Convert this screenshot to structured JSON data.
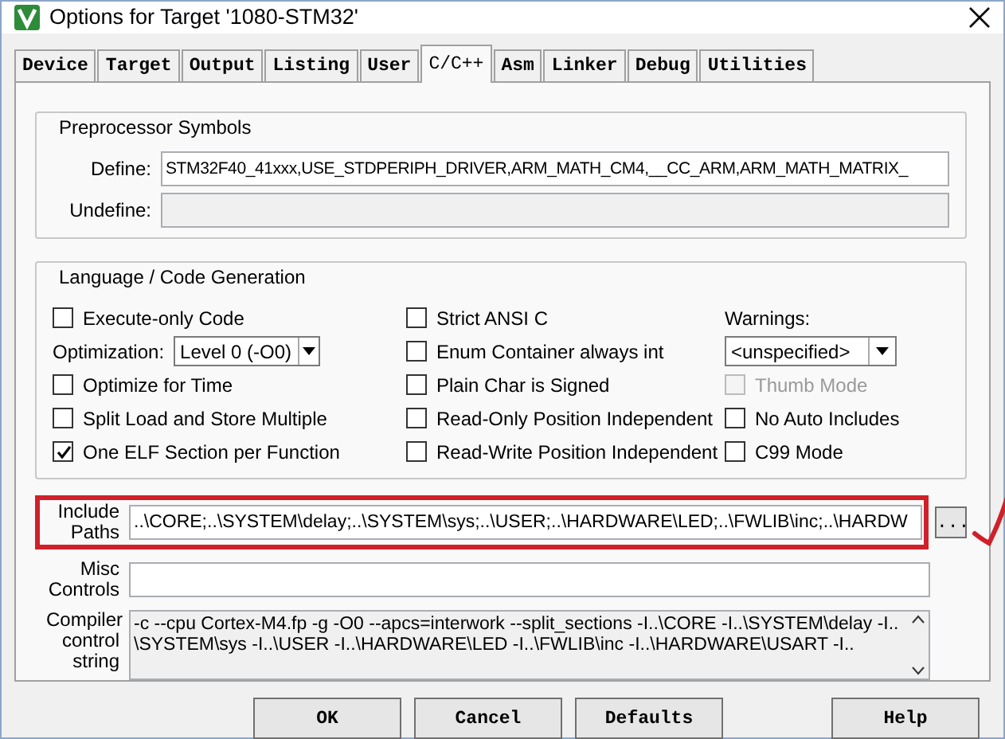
{
  "window": {
    "title": "Options for Target '1080-STM32'"
  },
  "tabs": [
    {
      "label": "Device",
      "selected": false
    },
    {
      "label": "Target",
      "selected": false
    },
    {
      "label": "Output",
      "selected": false
    },
    {
      "label": "Listing",
      "selected": false
    },
    {
      "label": "User",
      "selected": false
    },
    {
      "label": "C/C++",
      "selected": true
    },
    {
      "label": "Asm",
      "selected": false
    },
    {
      "label": "Linker",
      "selected": false
    },
    {
      "label": "Debug",
      "selected": false
    },
    {
      "label": "Utilities",
      "selected": false
    }
  ],
  "preprocessor": {
    "title": "Preprocessor Symbols",
    "define": {
      "label": "Define:",
      "value": "STM32F40_41xxx,USE_STDPERIPH_DRIVER,ARM_MATH_CM4,__CC_ARM,ARM_MATH_MATRIX_"
    },
    "undefine": {
      "label": "Undefine:"
    }
  },
  "language": {
    "title": "Language / Code Generation",
    "columns": [
      [
        {
          "kind": "checkbox",
          "label": "Execute-only Code",
          "checked": false,
          "disabled": false
        },
        {
          "kind": "select",
          "label": "Optimization:",
          "value": "Level 0 (-O0)"
        },
        {
          "kind": "checkbox",
          "label": "Optimize for Time",
          "checked": false,
          "disabled": false
        },
        {
          "kind": "checkbox",
          "label": "Split Load and Store Multiple",
          "checked": false,
          "disabled": false
        },
        {
          "kind": "checkbox",
          "label": "One ELF Section per Function",
          "checked": true,
          "disabled": false
        }
      ],
      [
        {
          "kind": "checkbox",
          "label": "Strict ANSI C",
          "checked": false,
          "disabled": false
        },
        {
          "kind": "checkbox",
          "label": "Enum Container always int",
          "checked": false,
          "disabled": false
        },
        {
          "kind": "checkbox",
          "label": "Plain Char is Signed",
          "checked": false,
          "disabled": false
        },
        {
          "kind": "checkbox",
          "label": "Read-Only Position Independent",
          "checked": false,
          "disabled": false
        },
        {
          "kind": "checkbox",
          "label": "Read-Write Position Independent",
          "checked": false,
          "disabled": false
        }
      ],
      [
        {
          "kind": "heading",
          "label": "Warnings:"
        },
        {
          "kind": "select",
          "value": "<unspecified>"
        },
        {
          "kind": "checkbox",
          "label": "Thumb Mode",
          "checked": false,
          "disabled": true
        },
        {
          "kind": "checkbox",
          "label": "No Auto Includes",
          "checked": false,
          "disabled": false
        },
        {
          "kind": "checkbox",
          "label": "C99 Mode",
          "checked": false,
          "disabled": false
        }
      ]
    ]
  },
  "include_paths": {
    "label": "Include Paths",
    "value": "..\\CORE;..\\SYSTEM\\delay;..\\SYSTEM\\sys;..\\USER;..\\HARDWARE\\LED;..\\FWLIB\\inc;..\\HARDW",
    "browse": "...",
    "highlighted": true
  },
  "misc_controls": {
    "label": "Misc Controls"
  },
  "compiler_string": {
    "label": "Compiler control string",
    "lines": [
      "-c --cpu Cortex-M4.fp -g -O0 --apcs=interwork --split_sections -I..\\CORE -I..\\SYSTEM\\delay -I..",
      "\\SYSTEM\\sys -I..\\USER -I..\\HARDWARE\\LED -I..\\FWLIB\\inc -I..\\HARDWARE\\USART -I.."
    ]
  },
  "buttons": [
    "OK",
    "Cancel",
    "Defaults",
    "Help"
  ]
}
